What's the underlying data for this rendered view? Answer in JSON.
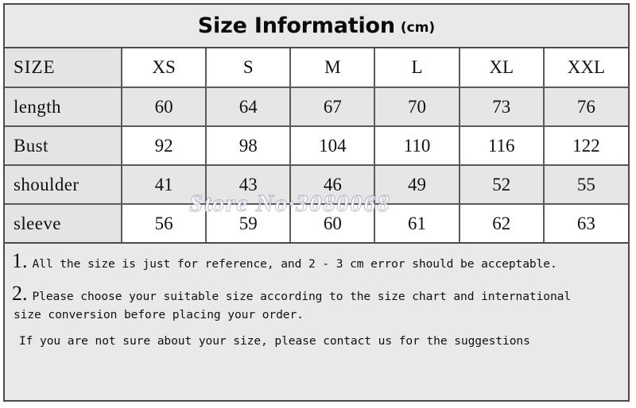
{
  "title": {
    "main": "Size Information",
    "unit": "(cm)"
  },
  "table": {
    "corner_label": "SIZE",
    "columns": [
      "XS",
      "S",
      "M",
      "L",
      "XL",
      "XXL"
    ],
    "rows": [
      {
        "label": "length",
        "values": [
          "60",
          "64",
          "67",
          "70",
          "73",
          "76"
        ]
      },
      {
        "label": "Bust",
        "values": [
          "92",
          "98",
          "104",
          "110",
          "116",
          "122"
        ]
      },
      {
        "label": "shoulder",
        "values": [
          "41",
          "43",
          "46",
          "49",
          "52",
          "55"
        ]
      },
      {
        "label": "sleeve",
        "values": [
          "56",
          "59",
          "60",
          "61",
          "62",
          "63"
        ]
      }
    ]
  },
  "notes": {
    "note1_num": "1.",
    "note1_text": "All the size is just for reference, and 2 - 3 cm error should be acceptable.",
    "note2_num": "2.",
    "note2_text": "Please choose your suitable size according to the size chart and international",
    "note2_cont": "size conversion before placing your order.",
    "note3_text": "If you are not sure about your size, please contact us for the suggestions"
  },
  "watermark": {
    "text": "Store  No·3080068"
  },
  "colors": {
    "background": "#e9e9e9",
    "cell_shaded": "#e6e6e6",
    "cell_plain": "#ffffff",
    "label_column": "#e4e4e4",
    "border": "#5a5a5a",
    "text": "#111111"
  }
}
